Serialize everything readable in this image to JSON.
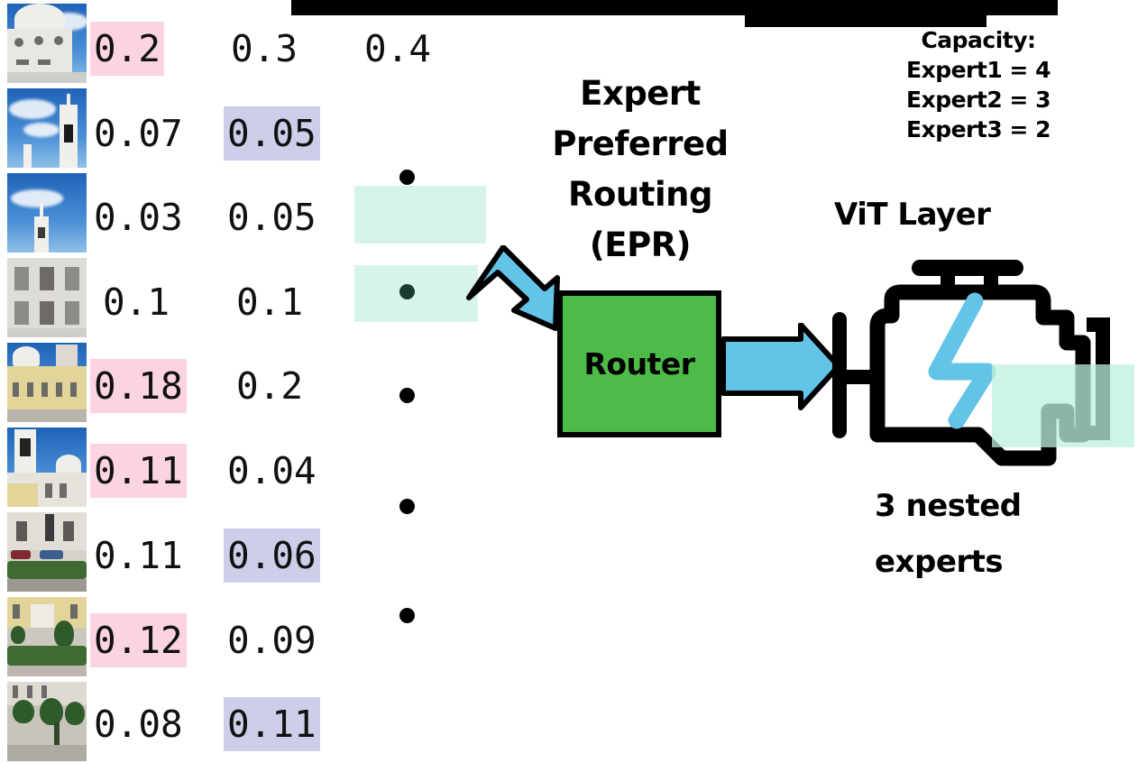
{
  "diagram": {
    "title_bars": [
      {
        "name": "redaction-bar-wide"
      },
      {
        "name": "redaction-bar-inner"
      }
    ],
    "token_rows": [
      {
        "thumb": "palace-dome-closeup",
        "expert1": "0.2",
        "expert1_hl": "pink",
        "expert2": "0.3",
        "expert2_hl": "none",
        "expert3": "0.4",
        "expert3_hl": "none"
      },
      {
        "thumb": "palace-belltower-sky",
        "expert1": "0.07",
        "expert1_hl": "none",
        "expert2": "0.05",
        "expert2_hl": "lavender"
      },
      {
        "thumb": "palace-spire-clouds",
        "expert1": "0.03",
        "expert1_hl": "none",
        "expert2": "0.05",
        "expert2_hl": "none"
      },
      {
        "thumb": "palace-facade-windows",
        "expert1": "0.1",
        "expert1_hl": "none",
        "expert2": "0.1",
        "expert2_hl": "none"
      },
      {
        "thumb": "palace-yellow-wing",
        "expert1": "0.18",
        "expert1_hl": "pink",
        "expert2": "0.2",
        "expert2_hl": "none"
      },
      {
        "thumb": "palace-basilica-front",
        "expert1": "0.11",
        "expert1_hl": "pink",
        "expert2": "0.04",
        "expert2_hl": "none"
      },
      {
        "thumb": "street-cars-hedge",
        "expert1": "0.11",
        "expert1_hl": "none",
        "expert2": "0.06",
        "expert2_hl": "lavender"
      },
      {
        "thumb": "garden-yellow-building",
        "expert1": "0.12",
        "expert1_hl": "pink",
        "expert2": "0.09",
        "expert2_hl": "none"
      },
      {
        "thumb": "garden-path-trees",
        "expert1": "0.08",
        "expert1_hl": "none",
        "expert2": "0.11",
        "expert2_hl": "lavender"
      }
    ],
    "epr_label": "Expert\nPreferred\nRouting\n(EPR)",
    "router_label": "Router",
    "capacity_label": "Capacity:\nExpert1 = 4\nExpert2 = 3\nExpert3 = 2",
    "vit_layer_label": "ViT Layer",
    "nested_experts_label": "3 nested\nexperts",
    "colors": {
      "highlight_pink": "#fbd3e3",
      "highlight_lavender": "#ccceea",
      "token_mint": "#d6f5e8",
      "router_green": "#4cbb47",
      "arrow_blue": "#63c4e8",
      "bolt_blue": "#63c4e8",
      "dark_green_dot": "#183b32",
      "outline_black": "#000000"
    },
    "ellipsis_dots": [
      {
        "name": "ellipsis-dot-1",
        "color": "#000000"
      },
      {
        "name": "ellipsis-dot-2",
        "color": "#183b32"
      },
      {
        "name": "ellipsis-dot-3",
        "color": "#000000"
      },
      {
        "name": "ellipsis-dot-4",
        "color": "#000000"
      },
      {
        "name": "ellipsis-dot-5",
        "color": "#000000"
      }
    ]
  }
}
